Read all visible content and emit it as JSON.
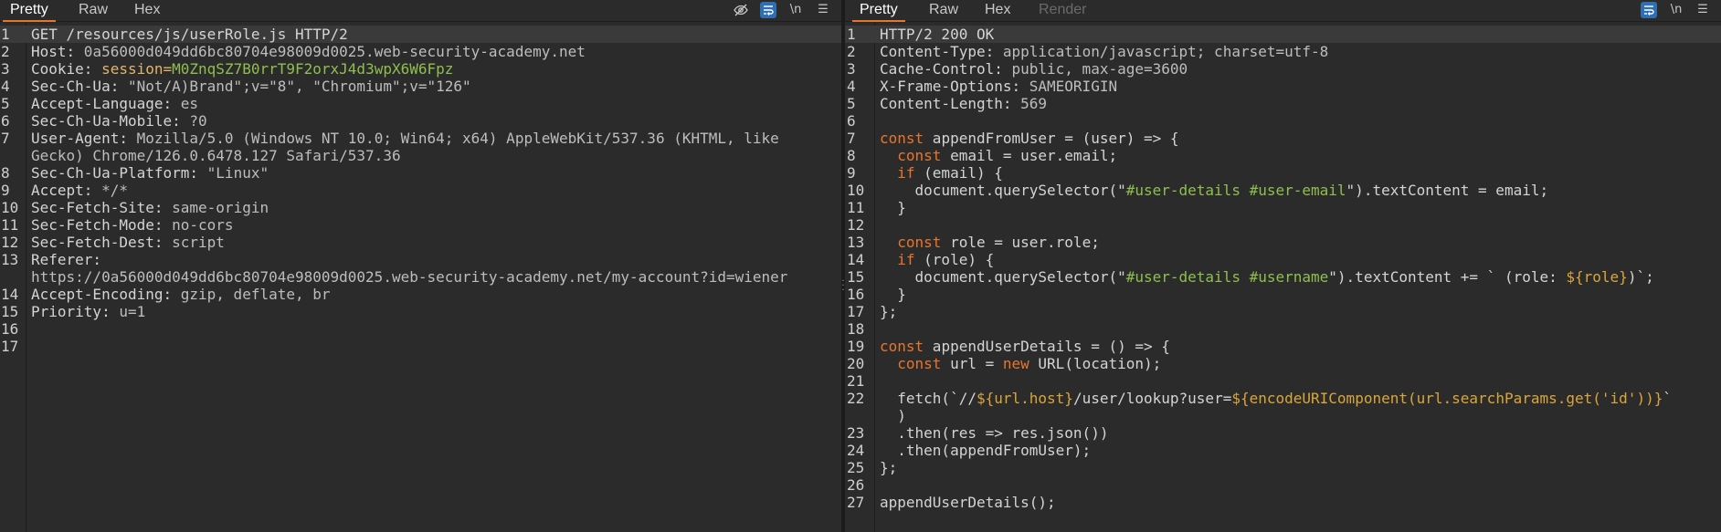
{
  "request": {
    "tabs": [
      "Pretty",
      "Raw",
      "Hex"
    ],
    "active_tab": "Pretty",
    "toolbar_icons": [
      "eye-slash-icon",
      "wrap-lines-icon",
      "newline-icon",
      "menu-icon"
    ],
    "newline_label": "\\n",
    "line_numbers": [
      "1",
      "2",
      "3",
      "4",
      "5",
      "6",
      "7",
      "",
      "8",
      "9",
      "10",
      "11",
      "12",
      "13",
      "",
      "14",
      "15",
      "16",
      "17"
    ],
    "lines": {
      "l1": "GET /resources/js/userRole.js HTTP/2",
      "l2_name": "Host:",
      "l2_val": " 0a56000d049dd6bc80704e98009d0025.web-security-academy.net",
      "l3_name": "Cookie:",
      "l3_cname": " session=",
      "l3_cval": "M0ZnqSZ7B0rrT9F2orxJ4d3wpX6W6Fpz",
      "l4_name": "Sec-Ch-Ua:",
      "l4_val": " \"Not/A)Brand\";v=\"8\", \"Chromium\";v=\"126\"",
      "l5_name": "Accept-Language:",
      "l5_val": " es",
      "l6_name": "Sec-Ch-Ua-Mobile:",
      "l6_val": " ?0",
      "l7_name": "User-Agent:",
      "l7_val": " Mozilla/5.0 (Windows NT 10.0; Win64; x64) AppleWebKit/537.36 (KHTML, like",
      "l7b": "Gecko) Chrome/126.0.6478.127 Safari/537.36",
      "l8_name": "Sec-Ch-Ua-Platform:",
      "l8_val": " \"Linux\"",
      "l9_name": "Accept:",
      "l9_val": " */*",
      "l10_name": "Sec-Fetch-Site:",
      "l10_val": " same-origin",
      "l11_name": "Sec-Fetch-Mode:",
      "l11_val": " no-cors",
      "l12_name": "Sec-Fetch-Dest:",
      "l12_val": " script",
      "l13_name": "Referer:",
      "l13b": "https://0a56000d049dd6bc80704e98009d0025.web-security-academy.net/my-account?id=wiener",
      "l14_name": "Accept-Encoding:",
      "l14_val": " gzip, deflate, br",
      "l15_name": "Priority:",
      "l15_val": " u=1"
    }
  },
  "response": {
    "tabs": [
      "Pretty",
      "Raw",
      "Hex",
      "Render"
    ],
    "active_tab": "Pretty",
    "toolbar_icons": [
      "wrap-lines-icon",
      "newline-icon",
      "menu-icon"
    ],
    "newline_label": "\\n",
    "line_numbers": [
      "1",
      "2",
      "3",
      "4",
      "5",
      "6",
      "7",
      "8",
      "9",
      "10",
      "11",
      "12",
      "13",
      "14",
      "15",
      "16",
      "17",
      "18",
      "19",
      "20",
      "21",
      "22",
      "",
      "23",
      "24",
      "25",
      "26",
      "27"
    ],
    "lines": {
      "r1": "HTTP/2 200 OK",
      "r2_name": "Content-Type:",
      "r2_val": " application/javascript; charset=utf-8",
      "r3_name": "Cache-Control:",
      "r3_val": " public, max-age=3600",
      "r4_name": "X-Frame-Options:",
      "r4_val": " SAMEORIGIN",
      "r5_name": "Content-Length:",
      "r5_val": " 569",
      "r7_kw": "const",
      "r7_rest": " appendFromUser = (user) => {",
      "r8_kw": "const",
      "r8_rest": " email = user.email;",
      "r9_kw": "if",
      "r9_rest": " (email) {",
      "r10_a": "document.querySelector(\"",
      "r10_sel": "#user-details #user-email",
      "r10_b": "\").textContent = email;",
      "r11": "}",
      "r13_kw": "const",
      "r13_rest": " role = user.role;",
      "r14_kw": "if",
      "r14_rest": " (role) {",
      "r15_a": "document.querySelector(\"",
      "r15_sel": "#user-details #username",
      "r15_b": "\").textContent += ` (role: ",
      "r15_tpl": "${role}",
      "r15_c": ")`;",
      "r16": "}",
      "r17": "};",
      "r19_kw": "const",
      "r19_rest": " appendUserDetails = () => {",
      "r20_kw": "const",
      "r20_mid": " url = ",
      "r20_kw2": "new",
      "r20_rest": " URL(location);",
      "r22_a": "fetch(`//",
      "r22_tpl1": "${url.host}",
      "r22_b": "/user/lookup?user=",
      "r22_tpl2": "${encodeURIComponent(url.searchParams.get('id'))}",
      "r22_c": "`",
      "r22b": ")",
      "r23": ".then(res => res.json())",
      "r24": ".then(appendFromUser);",
      "r25": "};",
      "r27": "appendUserDetails();"
    }
  }
}
